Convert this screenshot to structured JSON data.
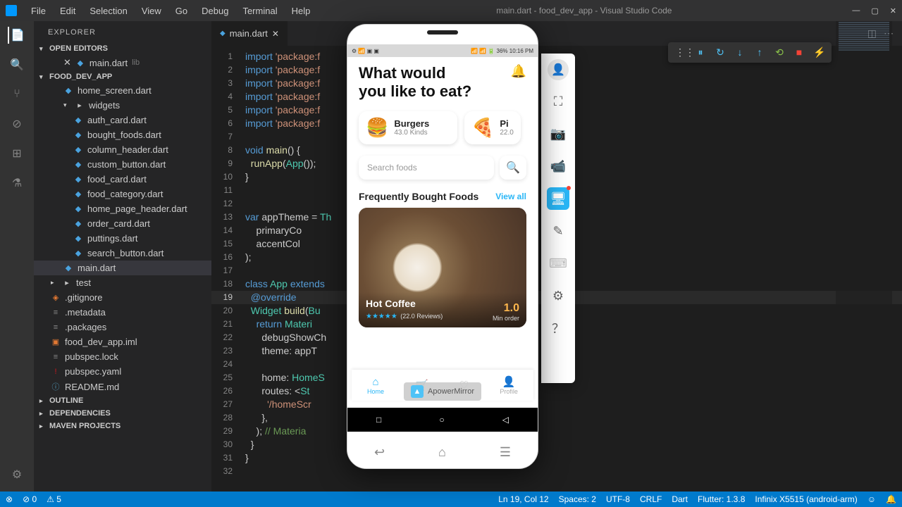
{
  "titlebar": {
    "menus": [
      "File",
      "Edit",
      "Selection",
      "View",
      "Go",
      "Debug",
      "Terminal",
      "Help"
    ],
    "title": "main.dart - food_dev_app - Visual Studio Code"
  },
  "sidebar": {
    "title": "EXPLORER",
    "sections": {
      "open_editors": "OPEN EDITORS",
      "project": "FOOD_DEV_APP",
      "outline": "OUTLINE",
      "dependencies": "DEPENDENCIES",
      "maven": "MAVEN PROJECTS"
    },
    "open_editor_item": {
      "name": "main.dart",
      "sub": "lib"
    },
    "tree": [
      {
        "name": "home_screen.dart",
        "depth": 2,
        "icon": "dart"
      },
      {
        "name": "widgets",
        "depth": 2,
        "icon": "folder",
        "expanded": true
      },
      {
        "name": "auth_card.dart",
        "depth": 3,
        "icon": "dart"
      },
      {
        "name": "bought_foods.dart",
        "depth": 3,
        "icon": "dart"
      },
      {
        "name": "column_header.dart",
        "depth": 3,
        "icon": "dart"
      },
      {
        "name": "custom_button.dart",
        "depth": 3,
        "icon": "dart"
      },
      {
        "name": "food_card.dart",
        "depth": 3,
        "icon": "dart"
      },
      {
        "name": "food_category.dart",
        "depth": 3,
        "icon": "dart"
      },
      {
        "name": "home_page_header.dart",
        "depth": 3,
        "icon": "dart"
      },
      {
        "name": "order_card.dart",
        "depth": 3,
        "icon": "dart"
      },
      {
        "name": "puttings.dart",
        "depth": 3,
        "icon": "dart"
      },
      {
        "name": "search_button.dart",
        "depth": 3,
        "icon": "dart"
      },
      {
        "name": "main.dart",
        "depth": 2,
        "icon": "dart",
        "selected": true
      },
      {
        "name": "test",
        "depth": 1,
        "icon": "folder"
      },
      {
        "name": ".gitignore",
        "depth": 1,
        "icon": "git"
      },
      {
        "name": ".metadata",
        "depth": 1,
        "icon": "file"
      },
      {
        "name": ".packages",
        "depth": 1,
        "icon": "file"
      },
      {
        "name": "food_dev_app.iml",
        "depth": 1,
        "icon": "iml"
      },
      {
        "name": "pubspec.lock",
        "depth": 1,
        "icon": "file"
      },
      {
        "name": "pubspec.yaml",
        "depth": 1,
        "icon": "yaml"
      },
      {
        "name": "README.md",
        "depth": 1,
        "icon": "md"
      }
    ]
  },
  "tab": {
    "name": "main.dart"
  },
  "code": {
    "lines": [
      "import 'package:f",
      "import 'package:f",
      "import 'package:f",
      "import 'package:f",
      "import 'package:f",
      "import 'package:f",
      "",
      "void main() {",
      "  runApp(App());",
      "}",
      "",
      "",
      "var appTheme = Th",
      "    primaryCo",
      "    accentCol",
      ");",
      "",
      "class App extends",
      "  @override",
      "  Widget build(Bu",
      "    return Materi",
      "      debugShowCh",
      "      theme: appT",
      "",
      "      home: HomeS",
      "      routes: <St",
      "        '/homeScr                              meScreen()",
      "      },",
      "    ); // Materia",
      "  }",
      "}",
      ""
    ],
    "active_line": 19
  },
  "statusbar": {
    "errors": "0",
    "warnings": "5",
    "position": "Ln 19, Col 12",
    "spaces": "Spaces: 2",
    "encoding": "UTF-8",
    "eol": "CRLF",
    "lang": "Dart",
    "flutter": "Flutter: 1.3.8",
    "device": "Infinix X5515 (android-arm)"
  },
  "phone": {
    "status_left": "⚙ 📶 ▣ ▣",
    "status_right": "📶 📶 🔋 36% 10:16 PM",
    "title_l1": "What would",
    "title_l2": "you like to eat?",
    "cat1": {
      "name": "Burgers",
      "sub": "43.0 Kinds",
      "emoji": "🍔"
    },
    "cat2": {
      "name": "Pi",
      "sub": "22.0",
      "emoji": "🍕"
    },
    "search_placeholder": "Search foods",
    "freq_title": "Frequently Bought Foods",
    "view_all": "View all",
    "food": {
      "name": "Hot Coffee",
      "reviews": "(22.0 Reviews)",
      "rating": "1.0",
      "min": "Min order"
    },
    "nav": [
      "Home",
      "",
      "",
      "Profile"
    ],
    "mirror_label": "ApowerMirror"
  }
}
